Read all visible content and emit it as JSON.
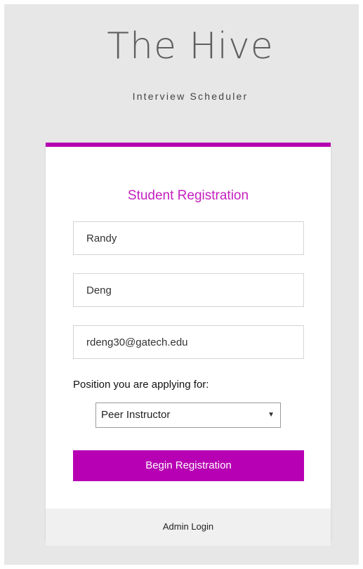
{
  "header": {
    "title": "The Hive",
    "subtitle": "Interview Scheduler"
  },
  "form": {
    "title": "Student Registration",
    "first_name": {
      "value": "Randy"
    },
    "last_name": {
      "value": "Deng"
    },
    "email": {
      "value": "rdeng30@gatech.edu"
    },
    "position_label": "Position you are applying for:",
    "position_select": {
      "selected": "Peer Instructor",
      "arrow_icon": "triangle-down-icon"
    },
    "submit_label": "Begin Registration"
  },
  "footer": {
    "admin_login_label": "Admin Login"
  },
  "colors": {
    "accent": "#b700b3",
    "title_accent": "#c41fbf",
    "page_background": "#e7e7e7",
    "footer_background": "#f0f0f0"
  }
}
